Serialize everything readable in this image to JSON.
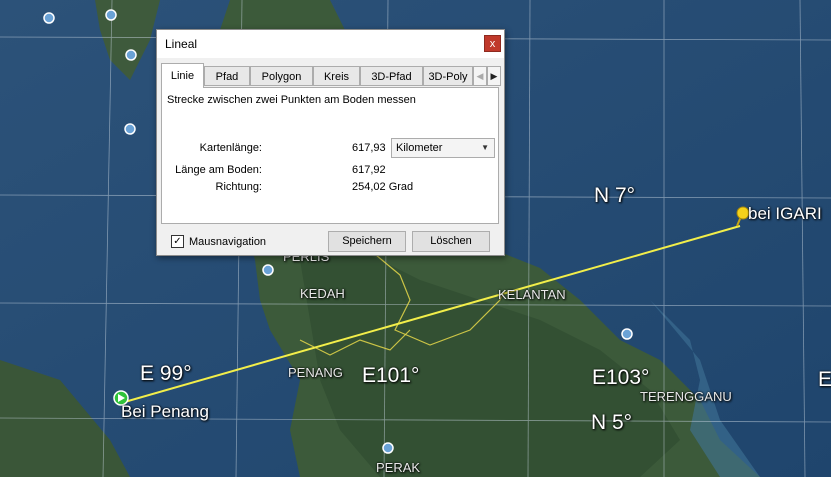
{
  "map": {
    "coords": {
      "e99": "E 99°",
      "e101": "E101°",
      "e103": "E103°",
      "e_edge": "E",
      "n7": "N 7°",
      "n5": "N 5°"
    },
    "regions": {
      "perlis": "PERLIS",
      "kedah": "KEDAH",
      "kelantan": "KELANTAN",
      "penang": "PENANG",
      "terengganu": "TERENGGANU",
      "perak": "PERAK"
    },
    "placemarks": {
      "start": "Bei Penang",
      "end": "bei IGARI"
    },
    "colors": {
      "ruler_line": "#f2ee4a",
      "start_marker": "#2fc33a",
      "end_pin": "#f4d21b"
    }
  },
  "dialog": {
    "title": "Lineal",
    "close_label": "x",
    "tabs": [
      "Linie",
      "Pfad",
      "Polygon",
      "Kreis",
      "3D-Pfad",
      "3D-Poly"
    ],
    "scroll_left": "◀",
    "scroll_right": "▶",
    "description": "Strecke zwischen zwei Punkten am Boden messen",
    "map_length_label": "Kartenlänge:",
    "map_length_value": "617,93",
    "unit": "Kilometer",
    "ground_length_label": "Länge am Boden:",
    "ground_length_value": "617,92",
    "heading_label": "Richtung:",
    "heading_value": "254,02 Grad",
    "mouse_nav_checked": "✓",
    "mouse_nav_label": "Mausnavigation",
    "save_label": "Speichern",
    "clear_label": "Löschen"
  }
}
